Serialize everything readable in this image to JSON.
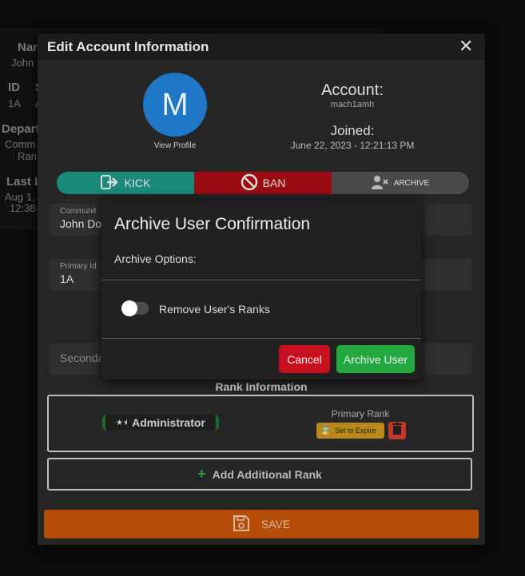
{
  "background": {
    "name_label": "Nam",
    "name_value": "John I",
    "id_label": "ID",
    "s_label": "S",
    "id_value": "1A",
    "a_value": "A",
    "dept_label": "Depart",
    "comm_value": "Comm",
    "rank_value": "Ran",
    "last_label": "Last L",
    "last_value1": "Aug 1,",
    "last_value2": "12:38"
  },
  "modal": {
    "title": "Edit Account Information",
    "close_glyph": "✕",
    "avatar_letter": "M",
    "view_profile": "View Profile",
    "account_label": "Account:",
    "account_value": "mach1amh",
    "joined_label": "Joined:",
    "joined_value": "June 22, 2023 - 12:21:13 PM",
    "actions": {
      "kick": "KICK",
      "ban": "BAN",
      "archive": "ARCHIVE"
    },
    "fields": {
      "community_label": "Communit",
      "community_value": "John Do",
      "primary_id_label": "Primary Id",
      "primary_id_value": "1A",
      "secondary_placeholder": "Seconda"
    },
    "rank_info_title": "Rank Information",
    "rank_name": "Administrator",
    "primary_rank_label": "Primary Rank",
    "set_expire_label": "Set to Expire",
    "add_rank_label": "Add Additional Rank",
    "save_label": "SAVE"
  },
  "confirm": {
    "title": "Archive User Confirmation",
    "options_label": "Archive Options:",
    "toggle_label": "Remove User's Ranks",
    "toggle_on": false,
    "cancel_label": "Cancel",
    "archive_label": "Archive User"
  },
  "colors": {
    "avatar": "#1f77c7",
    "kick": "#1a8a7a",
    "ban": "#9b0b12",
    "archive": "#4a4a4a",
    "save": "#b54d08",
    "cancel": "#c8101f",
    "archive_user": "#22a83e",
    "expire": "#b98a17"
  },
  "icons": {
    "kick": "sign-out-icon",
    "ban": "ban-icon",
    "archive": "user-x-icon",
    "rank": "star-icon",
    "expire": "hourglass-icon",
    "trash": "trash-icon",
    "add": "plus-icon",
    "save": "floppy-disk-icon",
    "close": "close-icon"
  }
}
